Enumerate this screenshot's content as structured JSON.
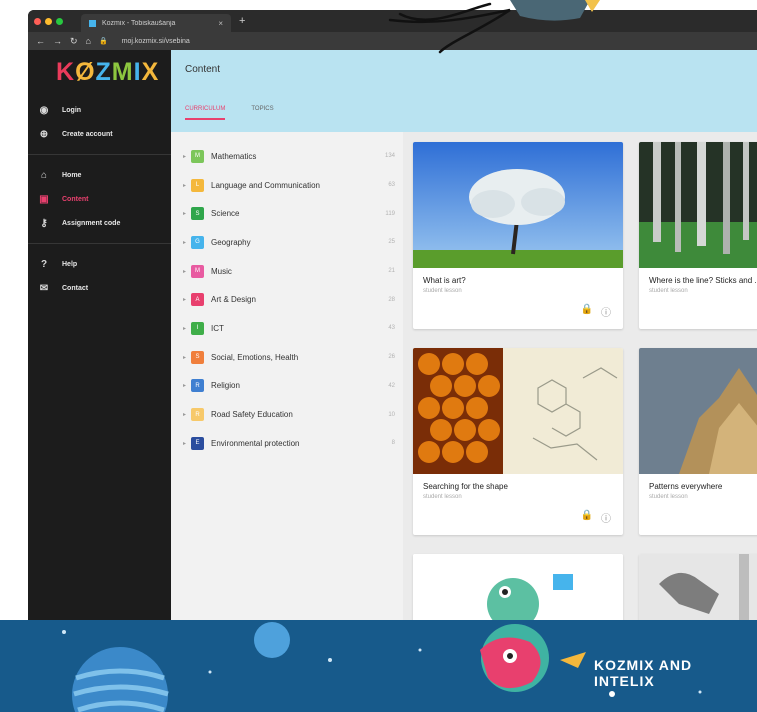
{
  "browser": {
    "tab_title": "Kozmix - Tobiskaušanja",
    "tab_close": "×",
    "new_tab": "+",
    "url": "moj.kozmix.si/vsebina"
  },
  "logo": {
    "letters": [
      "K",
      "Ø",
      "Z",
      "M",
      "I",
      "X"
    ]
  },
  "sidebar": {
    "items": [
      {
        "label": "Login",
        "icon": "user-icon"
      },
      {
        "label": "Create account",
        "icon": "user-add-icon"
      },
      {
        "label": "Home",
        "icon": "home-icon"
      },
      {
        "label": "Content",
        "icon": "content-icon"
      },
      {
        "label": "Assignment code",
        "icon": "key-icon"
      },
      {
        "label": "Help",
        "icon": "help-icon"
      },
      {
        "label": "Contact",
        "icon": "mail-icon"
      }
    ]
  },
  "header": {
    "title": "Content",
    "tabs": [
      "CURRICULUM",
      "TOPICS"
    ]
  },
  "categories": [
    {
      "name": "Mathematics",
      "count": "134",
      "color": "#7cc65a",
      "glyph": "M"
    },
    {
      "name": "Language and Communication",
      "count": "63",
      "color": "#f4b83c",
      "glyph": "L"
    },
    {
      "name": "Science",
      "count": "119",
      "color": "#2fa64b",
      "glyph": "S"
    },
    {
      "name": "Geography",
      "count": "25",
      "color": "#46b4ec",
      "glyph": "G"
    },
    {
      "name": "Music",
      "count": "21",
      "color": "#e85ba1",
      "glyph": "M"
    },
    {
      "name": "Art & Design",
      "count": "28",
      "color": "#e8406e",
      "glyph": "A"
    },
    {
      "name": "ICT",
      "count": "43",
      "color": "#3fae49",
      "glyph": "I"
    },
    {
      "name": "Social, Emotions, Health",
      "count": "26",
      "color": "#f07f3c",
      "glyph": "S"
    },
    {
      "name": "Religion",
      "count": "42",
      "color": "#3f7fd1",
      "glyph": "R"
    },
    {
      "name": "Road Safety Education",
      "count": "10",
      "color": "#f7c96a",
      "glyph": "R"
    },
    {
      "name": "Environmental protection",
      "count": "8",
      "color": "#2b4d9e",
      "glyph": "E"
    }
  ],
  "cards": [
    {
      "title": "What is art?",
      "subtitle": "student lesson"
    },
    {
      "title": "Where is the line? Sticks and ...",
      "subtitle": "student lesson"
    },
    {
      "title": "Searching for the shape",
      "subtitle": "student lesson"
    },
    {
      "title": "Patterns everywhere",
      "subtitle": "student lesson"
    }
  ],
  "banner": {
    "text": "KOZMIX AND INTELIX"
  },
  "colors": {
    "accent": "#e8406e",
    "header_bg": "#b9e3f1",
    "sidebar_bg": "#1c1c1c",
    "banner_bg": "#175a8b"
  }
}
